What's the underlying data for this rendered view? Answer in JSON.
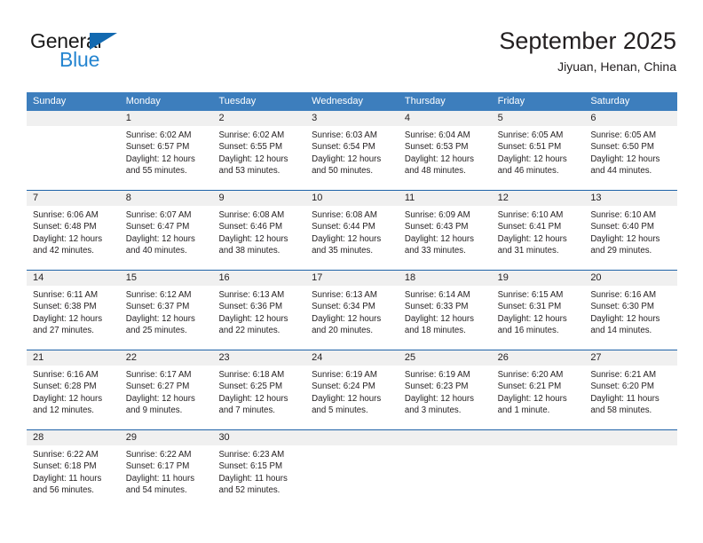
{
  "logo": {
    "word_top": "General",
    "word_bottom": "Blue",
    "triangle_icon": "blue-triangle-icon",
    "colors": {
      "general_text": "#1a1a1a",
      "blue_text": "#2585d0",
      "triangle": "#1269b0"
    }
  },
  "header": {
    "title": "September 2025",
    "location": "Jiyuan, Henan, China"
  },
  "theme": {
    "header_bar": "#3d7ebd",
    "row_divider": "#1f63a8",
    "daynum_band": "#f0f0f0",
    "text": "#231f20"
  },
  "weekdays": [
    "Sunday",
    "Monday",
    "Tuesday",
    "Wednesday",
    "Thursday",
    "Friday",
    "Saturday"
  ],
  "weeks": [
    [
      {
        "day": "",
        "lines": []
      },
      {
        "day": "1",
        "lines": [
          "Sunrise: 6:02 AM",
          "Sunset: 6:57 PM",
          "Daylight: 12 hours",
          "and 55 minutes."
        ]
      },
      {
        "day": "2",
        "lines": [
          "Sunrise: 6:02 AM",
          "Sunset: 6:55 PM",
          "Daylight: 12 hours",
          "and 53 minutes."
        ]
      },
      {
        "day": "3",
        "lines": [
          "Sunrise: 6:03 AM",
          "Sunset: 6:54 PM",
          "Daylight: 12 hours",
          "and 50 minutes."
        ]
      },
      {
        "day": "4",
        "lines": [
          "Sunrise: 6:04 AM",
          "Sunset: 6:53 PM",
          "Daylight: 12 hours",
          "and 48 minutes."
        ]
      },
      {
        "day": "5",
        "lines": [
          "Sunrise: 6:05 AM",
          "Sunset: 6:51 PM",
          "Daylight: 12 hours",
          "and 46 minutes."
        ]
      },
      {
        "day": "6",
        "lines": [
          "Sunrise: 6:05 AM",
          "Sunset: 6:50 PM",
          "Daylight: 12 hours",
          "and 44 minutes."
        ]
      }
    ],
    [
      {
        "day": "7",
        "lines": [
          "Sunrise: 6:06 AM",
          "Sunset: 6:48 PM",
          "Daylight: 12 hours",
          "and 42 minutes."
        ]
      },
      {
        "day": "8",
        "lines": [
          "Sunrise: 6:07 AM",
          "Sunset: 6:47 PM",
          "Daylight: 12 hours",
          "and 40 minutes."
        ]
      },
      {
        "day": "9",
        "lines": [
          "Sunrise: 6:08 AM",
          "Sunset: 6:46 PM",
          "Daylight: 12 hours",
          "and 38 minutes."
        ]
      },
      {
        "day": "10",
        "lines": [
          "Sunrise: 6:08 AM",
          "Sunset: 6:44 PM",
          "Daylight: 12 hours",
          "and 35 minutes."
        ]
      },
      {
        "day": "11",
        "lines": [
          "Sunrise: 6:09 AM",
          "Sunset: 6:43 PM",
          "Daylight: 12 hours",
          "and 33 minutes."
        ]
      },
      {
        "day": "12",
        "lines": [
          "Sunrise: 6:10 AM",
          "Sunset: 6:41 PM",
          "Daylight: 12 hours",
          "and 31 minutes."
        ]
      },
      {
        "day": "13",
        "lines": [
          "Sunrise: 6:10 AM",
          "Sunset: 6:40 PM",
          "Daylight: 12 hours",
          "and 29 minutes."
        ]
      }
    ],
    [
      {
        "day": "14",
        "lines": [
          "Sunrise: 6:11 AM",
          "Sunset: 6:38 PM",
          "Daylight: 12 hours",
          "and 27 minutes."
        ]
      },
      {
        "day": "15",
        "lines": [
          "Sunrise: 6:12 AM",
          "Sunset: 6:37 PM",
          "Daylight: 12 hours",
          "and 25 minutes."
        ]
      },
      {
        "day": "16",
        "lines": [
          "Sunrise: 6:13 AM",
          "Sunset: 6:36 PM",
          "Daylight: 12 hours",
          "and 22 minutes."
        ]
      },
      {
        "day": "17",
        "lines": [
          "Sunrise: 6:13 AM",
          "Sunset: 6:34 PM",
          "Daylight: 12 hours",
          "and 20 minutes."
        ]
      },
      {
        "day": "18",
        "lines": [
          "Sunrise: 6:14 AM",
          "Sunset: 6:33 PM",
          "Daylight: 12 hours",
          "and 18 minutes."
        ]
      },
      {
        "day": "19",
        "lines": [
          "Sunrise: 6:15 AM",
          "Sunset: 6:31 PM",
          "Daylight: 12 hours",
          "and 16 minutes."
        ]
      },
      {
        "day": "20",
        "lines": [
          "Sunrise: 6:16 AM",
          "Sunset: 6:30 PM",
          "Daylight: 12 hours",
          "and 14 minutes."
        ]
      }
    ],
    [
      {
        "day": "21",
        "lines": [
          "Sunrise: 6:16 AM",
          "Sunset: 6:28 PM",
          "Daylight: 12 hours",
          "and 12 minutes."
        ]
      },
      {
        "day": "22",
        "lines": [
          "Sunrise: 6:17 AM",
          "Sunset: 6:27 PM",
          "Daylight: 12 hours",
          "and 9 minutes."
        ]
      },
      {
        "day": "23",
        "lines": [
          "Sunrise: 6:18 AM",
          "Sunset: 6:25 PM",
          "Daylight: 12 hours",
          "and 7 minutes."
        ]
      },
      {
        "day": "24",
        "lines": [
          "Sunrise: 6:19 AM",
          "Sunset: 6:24 PM",
          "Daylight: 12 hours",
          "and 5 minutes."
        ]
      },
      {
        "day": "25",
        "lines": [
          "Sunrise: 6:19 AM",
          "Sunset: 6:23 PM",
          "Daylight: 12 hours",
          "and 3 minutes."
        ]
      },
      {
        "day": "26",
        "lines": [
          "Sunrise: 6:20 AM",
          "Sunset: 6:21 PM",
          "Daylight: 12 hours",
          "and 1 minute."
        ]
      },
      {
        "day": "27",
        "lines": [
          "Sunrise: 6:21 AM",
          "Sunset: 6:20 PM",
          "Daylight: 11 hours",
          "and 58 minutes."
        ]
      }
    ],
    [
      {
        "day": "28",
        "lines": [
          "Sunrise: 6:22 AM",
          "Sunset: 6:18 PM",
          "Daylight: 11 hours",
          "and 56 minutes."
        ]
      },
      {
        "day": "29",
        "lines": [
          "Sunrise: 6:22 AM",
          "Sunset: 6:17 PM",
          "Daylight: 11 hours",
          "and 54 minutes."
        ]
      },
      {
        "day": "30",
        "lines": [
          "Sunrise: 6:23 AM",
          "Sunset: 6:15 PM",
          "Daylight: 11 hours",
          "and 52 minutes."
        ]
      },
      {
        "day": "",
        "lines": []
      },
      {
        "day": "",
        "lines": []
      },
      {
        "day": "",
        "lines": []
      },
      {
        "day": "",
        "lines": []
      }
    ]
  ]
}
